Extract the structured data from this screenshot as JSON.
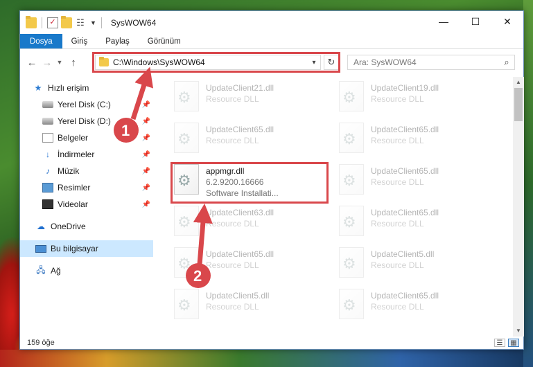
{
  "window": {
    "title": "SysWOW64",
    "controls": {
      "minimize": "—",
      "maximize": "☐",
      "close": "✕"
    }
  },
  "ribbon": {
    "tabs": [
      {
        "label": "Dosya"
      },
      {
        "label": "Giriş"
      },
      {
        "label": "Paylaş"
      },
      {
        "label": "Görünüm"
      }
    ]
  },
  "navigation": {
    "address": "C:\\Windows\\SysWOW64",
    "search_placeholder": "Ara: SysWOW64"
  },
  "sidebar": {
    "items": [
      {
        "label": "Hızlı erişim",
        "icon": "star-icon"
      },
      {
        "label": "Yerel Disk (C:)",
        "icon": "disk-icon",
        "pinned": true
      },
      {
        "label": "Yerel Disk (D:)",
        "icon": "disk-icon",
        "pinned": true
      },
      {
        "label": "Belgeler",
        "icon": "document-icon",
        "pinned": true
      },
      {
        "label": "İndirmeler",
        "icon": "download-icon",
        "pinned": true
      },
      {
        "label": "Müzik",
        "icon": "music-icon",
        "pinned": true
      },
      {
        "label": "Resimler",
        "icon": "pictures-icon",
        "pinned": true
      },
      {
        "label": "Videolar",
        "icon": "video-icon",
        "pinned": true
      },
      {
        "label": "OneDrive",
        "icon": "cloud-icon"
      },
      {
        "label": "Bu bilgisayar",
        "icon": "computer-icon",
        "selected": true
      },
      {
        "label": "Ağ",
        "icon": "network-icon"
      }
    ]
  },
  "files": {
    "highlighted": {
      "name": "appmgr.dll",
      "version": "6.2.9200.16666",
      "description": "Software Installati..."
    },
    "left_column": [
      {
        "name": "UpdateClient21.dll",
        "desc": "Resource DLL"
      },
      {
        "name": "UpdateClient65.dll",
        "desc": "Resource DLL"
      },
      {
        "name": "UpdateClient63.dll",
        "desc": "Resource DLL"
      },
      {
        "name": "UpdateClient65.dll",
        "desc": "Resource DLL"
      },
      {
        "name": "UpdateClient5.dll",
        "desc": "Resource DLL"
      }
    ],
    "right_column": [
      {
        "name": "UpdateClient19.dll",
        "desc": "Resource DLL"
      },
      {
        "name": "UpdateClient65.dll",
        "desc": "Resource DLL"
      },
      {
        "name": "UpdateClient65.dll",
        "desc": "Resource DLL"
      },
      {
        "name": "UpdateClient65.dll",
        "desc": "Resource DLL"
      },
      {
        "name": "UpdateClient5.dll",
        "desc": "Resource DLL"
      },
      {
        "name": "UpdateClient65.dll",
        "desc": "Resource DLL"
      }
    ]
  },
  "annotations": {
    "step1": "1",
    "step2": "2",
    "color": "#d9474b"
  },
  "status": {
    "count": "159 öğe"
  }
}
